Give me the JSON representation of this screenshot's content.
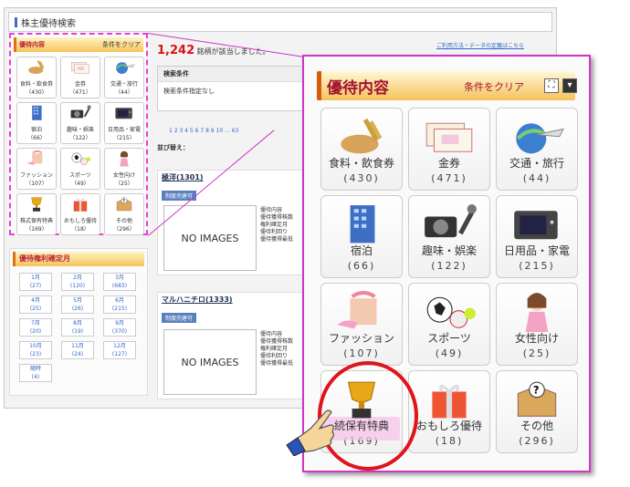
{
  "title": "株主優待検索",
  "count_value": "1,242",
  "count_suffix": "銘柄が該当しました。",
  "help_link": "ご利用方法・データの定義はこちら",
  "panel": {
    "title": "優待内容",
    "clear": "条件をクリア"
  },
  "month_panel": {
    "title": "優待権利確定月"
  },
  "categories": [
    {
      "label": "食料・飲食券",
      "count": "（430）"
    },
    {
      "label": "金券",
      "count": "（471）"
    },
    {
      "label": "交通・旅行",
      "count": "（44）"
    },
    {
      "label": "宿泊",
      "count": "（66）"
    },
    {
      "label": "趣味・娯楽",
      "count": "（122）"
    },
    {
      "label": "日用品・家電",
      "count": "（215）"
    },
    {
      "label": "ファッション",
      "count": "（107）"
    },
    {
      "label": "スポーツ",
      "count": "（49）"
    },
    {
      "label": "女性向け",
      "count": "（25）"
    },
    {
      "label": "株式保有特典",
      "count": "（169）"
    },
    {
      "label": "おもしろ優待",
      "count": "（18）"
    },
    {
      "label": "その他",
      "count": "（296）"
    }
  ],
  "zoom_labels": [
    "食料・飲食券",
    "金券",
    "交通・旅行",
    "宿泊",
    "趣味・娯楽",
    "日用品・家電",
    "ファッション",
    "スポーツ",
    "女性向け",
    "続保有特典",
    "おもしろ優待",
    "その他"
  ],
  "zoom_counts": [
    "(430)",
    "(471)",
    "(44)",
    "(66)",
    "(122)",
    "(215)",
    "(107)",
    "(49)",
    "(25)",
    "(169)",
    "(18)",
    "(296)"
  ],
  "months": [
    {
      "m": "1月",
      "c": "(27)"
    },
    {
      "m": "2月",
      "c": "(120)"
    },
    {
      "m": "3月",
      "c": "(683)"
    },
    {
      "m": "4月",
      "c": "(25)"
    },
    {
      "m": "5月",
      "c": "(26)"
    },
    {
      "m": "6月",
      "c": "(215)"
    },
    {
      "m": "7月",
      "c": "(20)"
    },
    {
      "m": "8月",
      "c": "(19)"
    },
    {
      "m": "9月",
      "c": "(370)"
    },
    {
      "m": "10月",
      "c": "(23)"
    },
    {
      "m": "11月",
      "c": "(24)"
    },
    {
      "m": "12月",
      "c": "(127)"
    },
    {
      "m": "随時",
      "c": "(4)"
    }
  ],
  "search_cond": {
    "header": "検索条件",
    "body": "検索条件指定なし"
  },
  "pager": "1 2 3 4 5 6 7 8 9 10 ... 63",
  "sort_label": "並び替え：",
  "results": [
    {
      "name": "極洋(1301)",
      "tag": "制度売建可",
      "noimg": "NO IMAGES",
      "meta": [
        "優待内容",
        "優待獲得株数",
        "権利確定月",
        "優待利回り",
        "優待獲得最低"
      ]
    },
    {
      "name": "マルハニチロ(1333)",
      "tag": "制度売建可",
      "noimg": "NO IMAGES",
      "meta": [
        "優待内容",
        "優待獲得株数",
        "権利確定月",
        "優待利回り",
        "優待獲得最低"
      ]
    }
  ],
  "colors": {
    "accent": "#d233c9",
    "highlight": "#e0151c",
    "title_red": "#a3122e"
  }
}
